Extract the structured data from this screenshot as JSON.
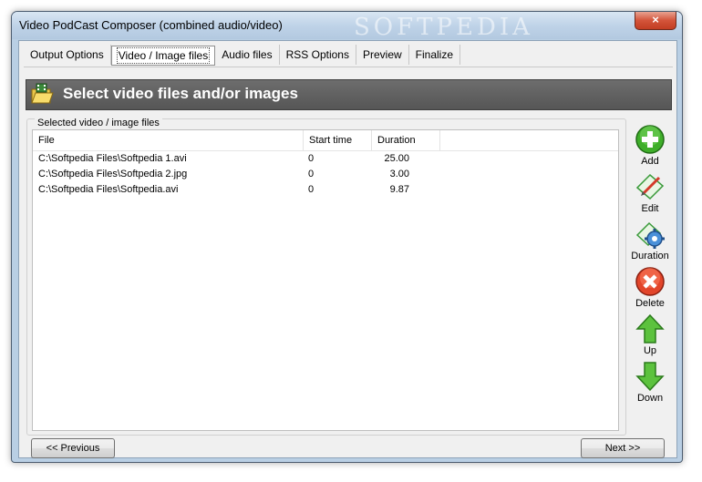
{
  "window": {
    "title": "Video PodCast Composer (combined audio/video)",
    "watermark": "SOFTPEDIA",
    "close_label": "×"
  },
  "tabs": [
    {
      "label": "Output Options",
      "active": false
    },
    {
      "label": "Video / Image files",
      "active": true
    },
    {
      "label": "Audio files",
      "active": false
    },
    {
      "label": "RSS Options",
      "active": false
    },
    {
      "label": "Preview",
      "active": false
    },
    {
      "label": "Finalize",
      "active": false
    }
  ],
  "banner": {
    "title": "Select video files and/or images",
    "icon": "folder-film-icon"
  },
  "group": {
    "label": "Selected video / image files"
  },
  "list": {
    "columns": [
      "File",
      "Start time",
      "Duration"
    ],
    "rows": [
      {
        "file": "C:\\Softpedia Files\\Softpedia 1.avi",
        "start": "0",
        "duration": "25.00"
      },
      {
        "file": "C:\\Softpedia Files\\Softpedia 2.jpg",
        "start": "0",
        "duration": "3.00"
      },
      {
        "file": "C:\\Softpedia Files\\Softpedia.avi",
        "start": "0",
        "duration": "9.87"
      }
    ]
  },
  "side_buttons": [
    {
      "label": "Add",
      "icon": "plus-icon"
    },
    {
      "label": "Edit",
      "icon": "pencil-icon"
    },
    {
      "label": "Duration",
      "icon": "gear-icon"
    },
    {
      "label": "Delete",
      "icon": "delete-icon"
    },
    {
      "label": "Up",
      "icon": "arrow-up-icon"
    },
    {
      "label": "Down",
      "icon": "arrow-down-icon"
    }
  ],
  "nav": {
    "previous_label": "<< Previous",
    "next_label": "Next >>"
  }
}
